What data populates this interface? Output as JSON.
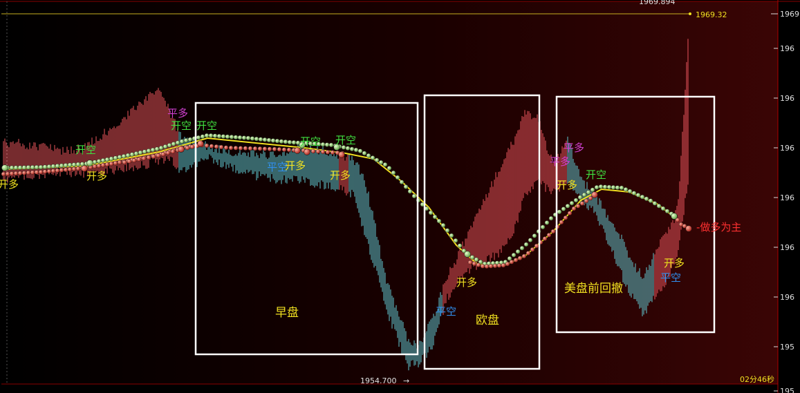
{
  "header": {
    "top_price": "1969.894",
    "current_price": "1969.32"
  },
  "footer": {
    "low_price": "1954.700",
    "timer": "02分46秒"
  },
  "colors": {
    "up": "#e8555c",
    "down": "#5fc7cf",
    "ma_fast": "#f0e020",
    "dots_upper": "#9ad37a",
    "dots_lower": "#e0463f",
    "box": "#ffffff"
  },
  "chart_data": {
    "type": "bar",
    "y_tick_labels": [
      "1969",
      "196",
      "196",
      "196",
      "196",
      "196",
      "196",
      "195",
      "195"
    ],
    "signals": [
      {
        "text": "开多",
        "color": "#f0e020"
      },
      {
        "text": "开空",
        "color": "#40e040"
      },
      {
        "text": "开多",
        "color": "#f0e020"
      },
      {
        "text": "平多",
        "color": "#d040d0"
      },
      {
        "text": "开空",
        "color": "#40e040"
      },
      {
        "text": "开空",
        "color": "#40e040"
      },
      {
        "text": "平空",
        "color": "#3090f0"
      },
      {
        "text": "开多",
        "color": "#f0e020"
      },
      {
        "text": "开空",
        "color": "#40e040"
      },
      {
        "text": "开空",
        "color": "#40e040"
      },
      {
        "text": "开多",
        "color": "#f0e020"
      },
      {
        "text": "平空",
        "color": "#3090f0"
      },
      {
        "text": "开多",
        "color": "#f0e020"
      },
      {
        "text": "平多",
        "color": "#d040d0"
      },
      {
        "text": "平多",
        "color": "#d040d0"
      },
      {
        "text": "开多",
        "color": "#f0e020"
      },
      {
        "text": "开空",
        "color": "#40e040"
      },
      {
        "text": "开多",
        "color": "#f0e020"
      },
      {
        "text": "平空",
        "color": "#3090f0"
      }
    ],
    "annotations": [
      {
        "text": "早盘",
        "color": "#f0e020"
      },
      {
        "text": "欧盘",
        "color": "#f0e020"
      },
      {
        "text": "美盘前回撤",
        "color": "#f0e020"
      },
      {
        "text": "-做多为主",
        "color": "#ff3030"
      }
    ]
  }
}
